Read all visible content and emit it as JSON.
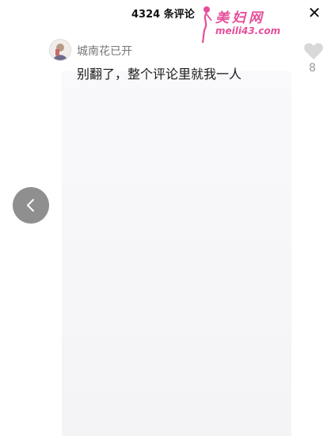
{
  "header": {
    "title": "4324 条评论",
    "close_label": "✕"
  },
  "watermark": {
    "text_cn": "美妇网",
    "url": "meili43.com"
  },
  "comment": {
    "author": "城南花已开",
    "text": "别翻了，整个评论里就我一人",
    "likes": "8"
  },
  "icons": {
    "close": "close-icon",
    "like": "heart-icon",
    "back": "chevron-left-icon",
    "avatar": "avatar"
  },
  "colors": {
    "watermark": "#e54f9b",
    "like": "#d8d8d8",
    "back_button": "#8f8f8f"
  }
}
